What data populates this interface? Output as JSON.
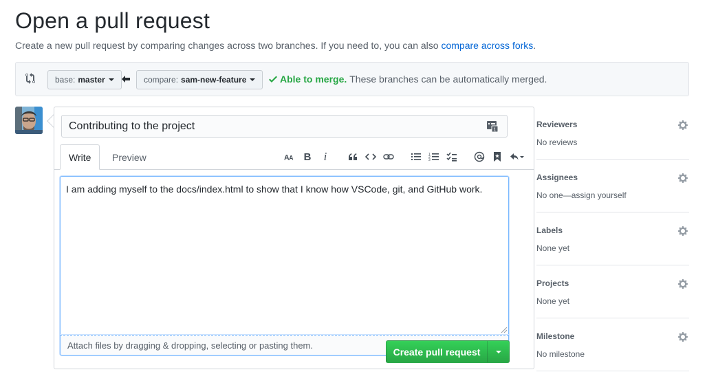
{
  "header": {
    "title": "Open a pull request",
    "subtitle": "Create a new pull request by comparing changes across two branches. If you need to, you can also",
    "subtitle_link": "compare across forks",
    "subtitle_end": "."
  },
  "range": {
    "base_prefix": "base:",
    "base_value": "master",
    "compare_prefix": "compare:",
    "compare_value": "sam-new-feature",
    "merge_ok": "Able to merge.",
    "merge_text": "These branches can be automatically merged."
  },
  "composer": {
    "title_value": "Contributing to the project",
    "tabs": [
      {
        "label": "Write"
      },
      {
        "label": "Preview"
      }
    ],
    "toolbar": {
      "heading_icon": "text-size-icon",
      "bold": "B",
      "italic": "i",
      "quote_icon": "quote-icon",
      "code_icon": "code-icon",
      "link_icon": "link-icon",
      "ul_icon": "list-unordered-icon",
      "ol_icon": "list-ordered-icon",
      "task_icon": "tasklist-icon",
      "mention_icon": "mention-icon",
      "ref_icon": "bookmark-icon",
      "reply_icon": "reply-icon"
    },
    "body_value": "I am adding myself to the docs/index.html to show that I know how VSCode, git, and GitHub work.",
    "attach_text": "Attach files by dragging & dropping, selecting or pasting them.",
    "submit_label": "Create pull request"
  },
  "sidebar": {
    "sections": [
      {
        "title": "Reviewers",
        "value": "No reviews"
      },
      {
        "title": "Assignees",
        "value": "No one—assign yourself"
      },
      {
        "title": "Labels",
        "value": "None yet"
      },
      {
        "title": "Projects",
        "value": "None yet"
      },
      {
        "title": "Milestone",
        "value": "No milestone"
      }
    ]
  },
  "colors": {
    "accent": "#0366d6",
    "success": "#28a745",
    "focus": "#79b8ff"
  }
}
